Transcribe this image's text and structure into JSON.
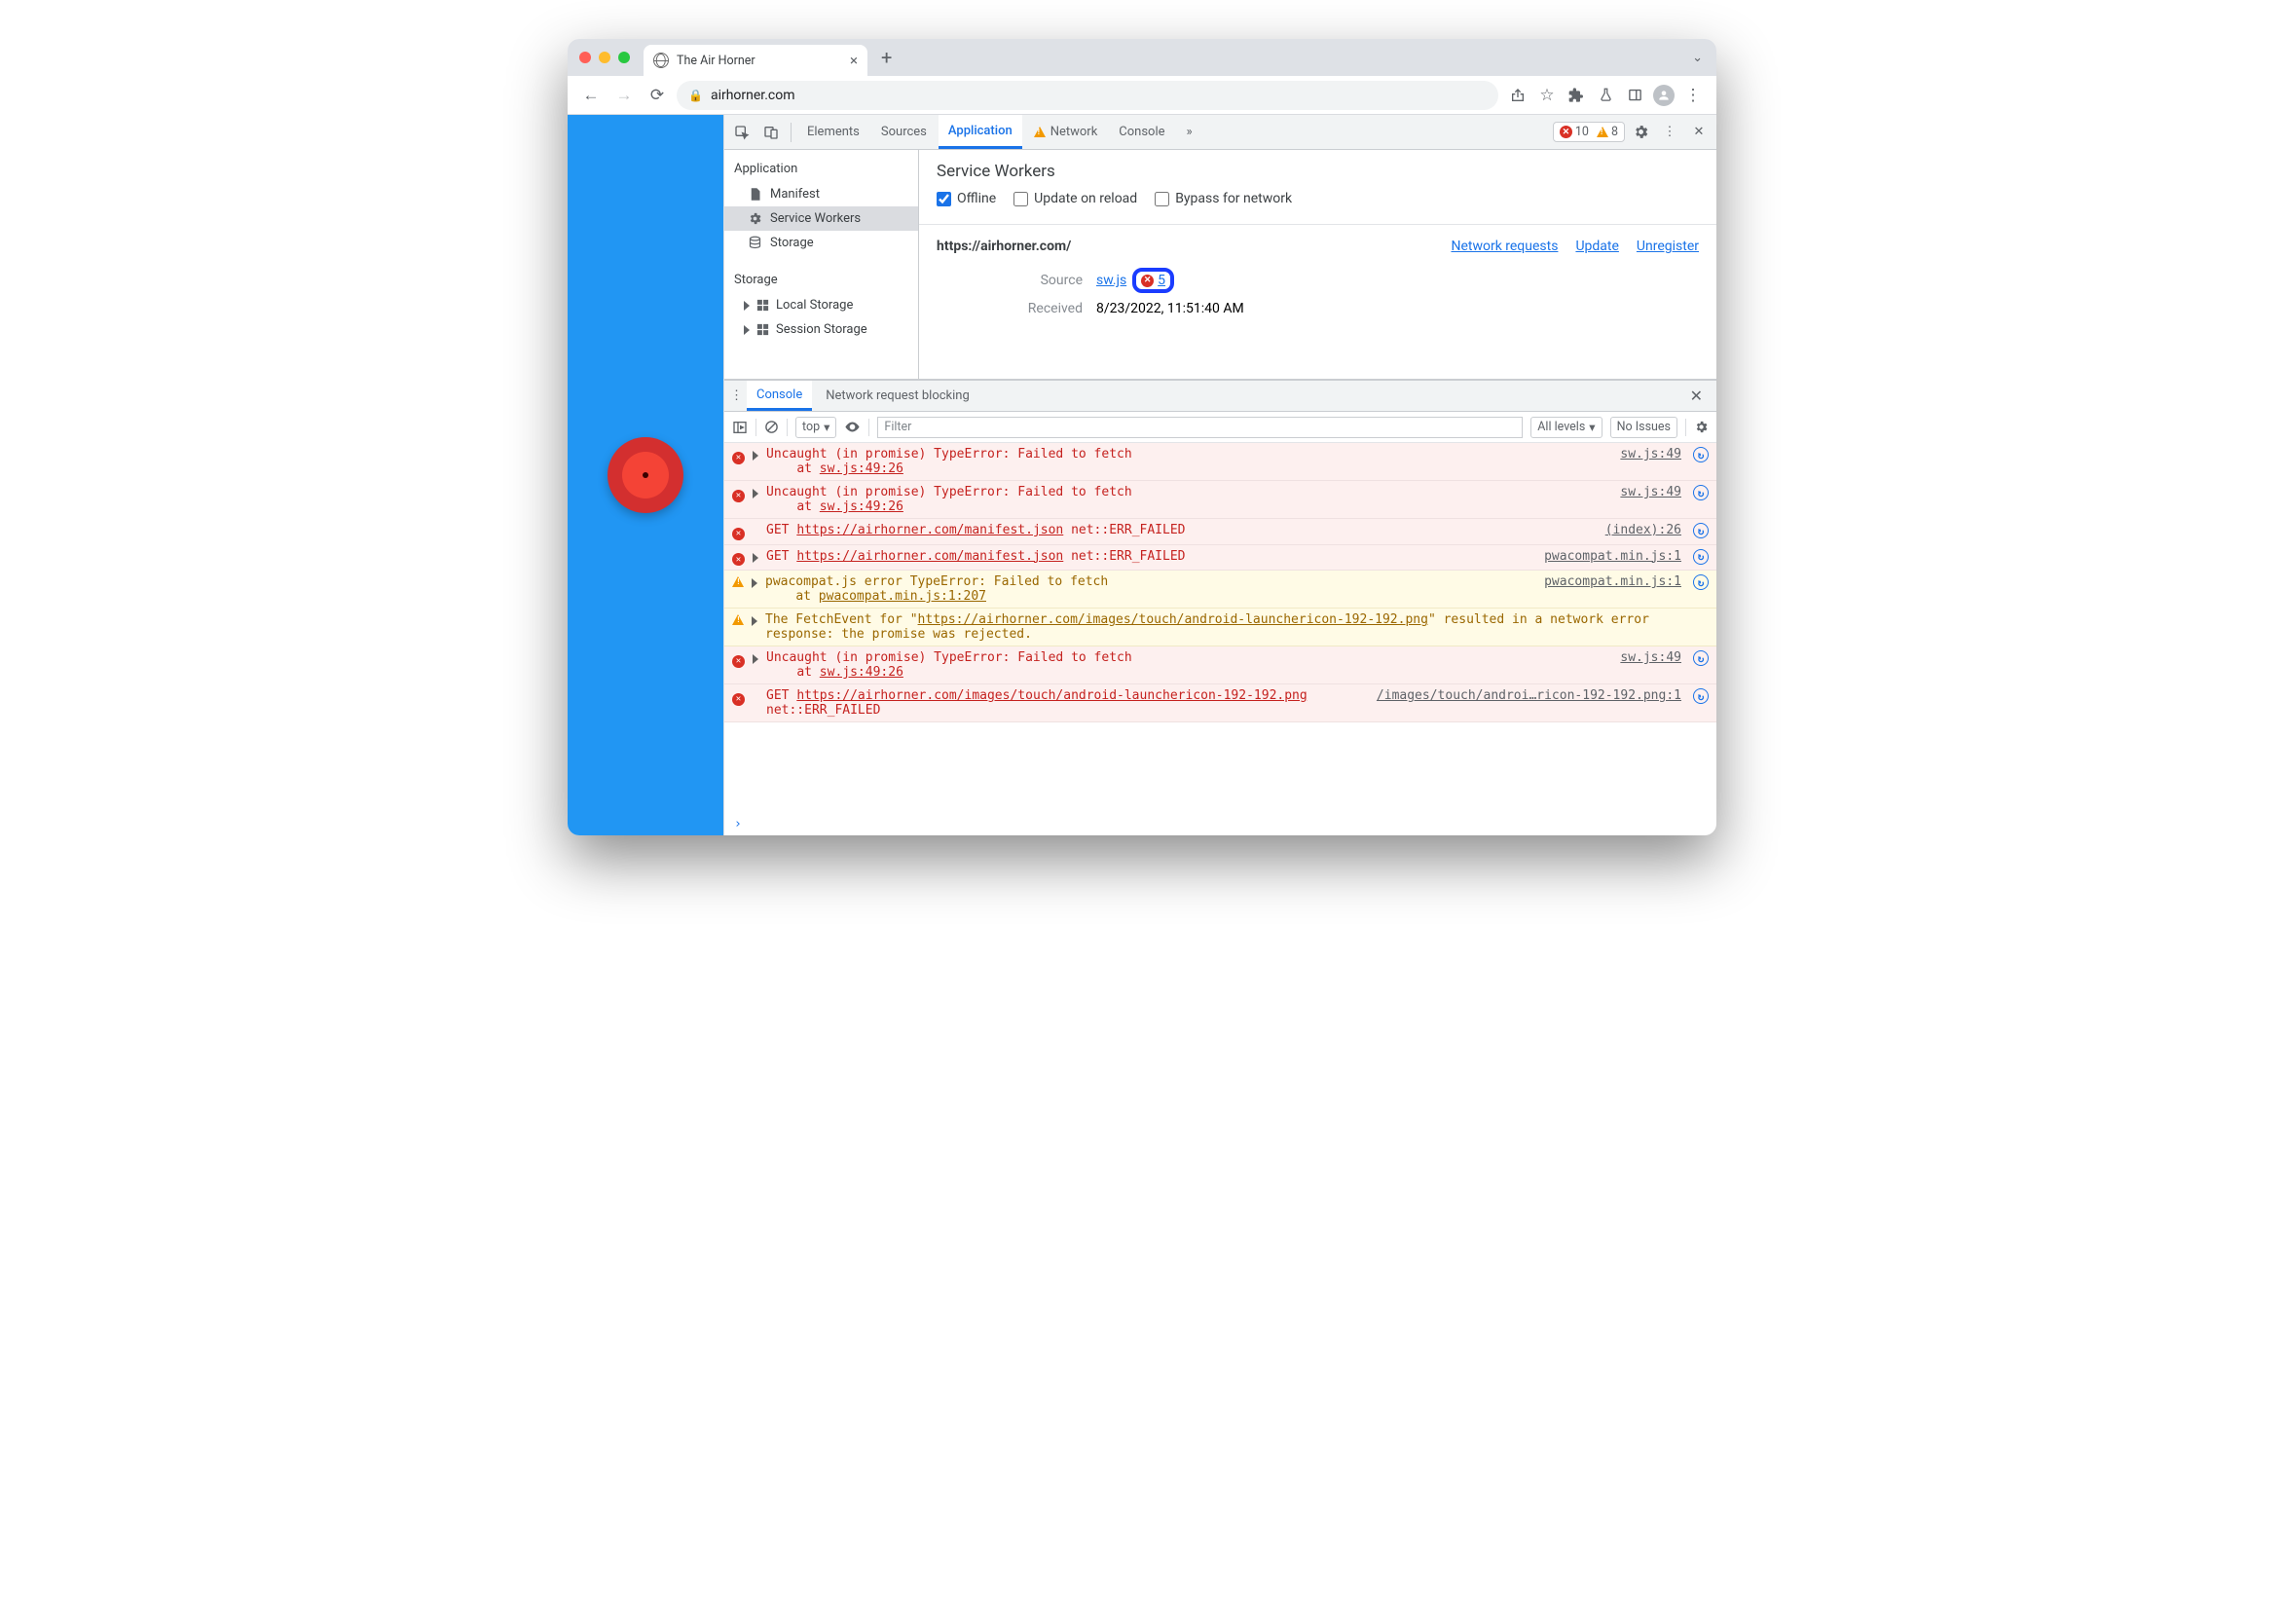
{
  "browser": {
    "tab_title": "The Air Horner",
    "url": "airhorner.com"
  },
  "devtools": {
    "tabs": [
      "Elements",
      "Sources",
      "Application",
      "Network",
      "Console"
    ],
    "active_tab": "Application",
    "error_count": "10",
    "warning_count": "8"
  },
  "app_sidebar": {
    "section1": "Application",
    "items1": [
      "Manifest",
      "Service Workers",
      "Storage"
    ],
    "section2": "Storage",
    "items2": [
      "Local Storage",
      "Session Storage"
    ]
  },
  "sw_panel": {
    "title": "Service Workers",
    "chk_offline": "Offline",
    "chk_update": "Update on reload",
    "chk_bypass": "Bypass for network",
    "origin": "https://airhorner.com/",
    "link_network": "Network requests",
    "link_update": "Update",
    "link_unregister": "Unregister",
    "lbl_source": "Source",
    "source_file": "sw.js",
    "error_badge": "5",
    "lbl_received": "Received",
    "received_val": "8/23/2022, 11:51:40 AM"
  },
  "drawer": {
    "tabs": [
      "Console",
      "Network request blocking"
    ],
    "context": "top",
    "filter_placeholder": "Filter",
    "levels": "All levels",
    "issues": "No Issues"
  },
  "console": [
    {
      "type": "err",
      "expand": true,
      "msg_pre": "Uncaught (in promise) TypeError: Failed to fetch\n    at ",
      "msg_link": "sw.js:49:26",
      "loc": "sw.js:49"
    },
    {
      "type": "err",
      "expand": true,
      "msg_pre": "Uncaught (in promise) TypeError: Failed to fetch\n    at ",
      "msg_link": "sw.js:49:26",
      "loc": "sw.js:49"
    },
    {
      "type": "err",
      "expand": false,
      "prefix": "GET ",
      "msg_link": "https://airhorner.com/manifest.json",
      "suffix": " net::ERR_FAILED",
      "loc": "(index):26"
    },
    {
      "type": "err",
      "expand": true,
      "prefix": "GET ",
      "msg_link": "https://airhorner.com/manifest.json",
      "suffix": " net::ERR_FAILED",
      "loc": "pwacompat.min.js:1"
    },
    {
      "type": "warn",
      "expand": true,
      "msg_pre": "pwacompat.js error TypeError: Failed to fetch\n    at ",
      "msg_link": "pwacompat.min.js:1:207",
      "loc": "pwacompat.min.js:1"
    },
    {
      "type": "warn",
      "expand": true,
      "msg_pre": "The FetchEvent for \"",
      "msg_link": "https://airhorner.com/images/touch/android-launchericon-192-192.png",
      "suffix": "\" resulted in a network error response: the promise was rejected.",
      "loc": ""
    },
    {
      "type": "err",
      "expand": true,
      "msg_pre": "Uncaught (in promise) TypeError: Failed to fetch\n    at ",
      "msg_link": "sw.js:49:26",
      "loc": "sw.js:49"
    },
    {
      "type": "err",
      "expand": false,
      "prefix": "GET ",
      "msg_link": "https://airhorner.com/images/touch/android-launchericon-192-192.png",
      "suffix": " net::ERR_FAILED",
      "loc": "/images/touch/androi…ricon-192-192.png:1"
    }
  ]
}
